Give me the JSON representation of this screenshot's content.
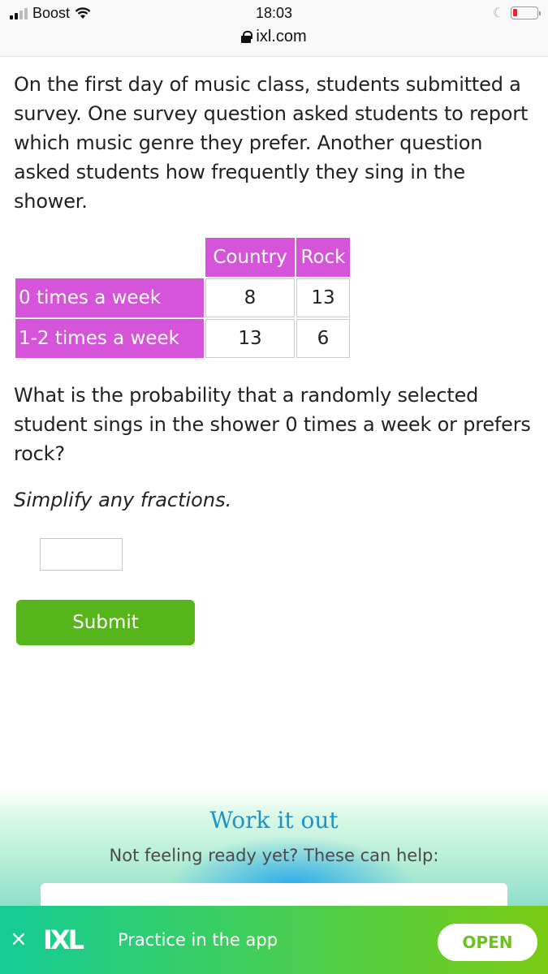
{
  "status_bar": {
    "carrier": "Boost",
    "time": "18:03",
    "url": "ixl.com",
    "icons": {
      "signal": "signal-bars-icon",
      "wifi": "wifi-icon",
      "lock": "lock-icon",
      "moon": "do-not-disturb-moon-icon",
      "battery": "battery-low-icon"
    },
    "battery_level_percent": 10,
    "battery_color": "#e8252c"
  },
  "question": {
    "intro": "On the first day of music class, students submitted a survey. One survey question asked students to report which music genre they prefer. Another question asked students how frequently they sing in the shower.",
    "table": {
      "header_color": "#d654d9",
      "columns": [
        "Country",
        "Rock"
      ],
      "rows": [
        {
          "label": "0 times a week",
          "values": [
            "8",
            "13"
          ]
        },
        {
          "label": "1-2 times a week",
          "values": [
            "13",
            "6"
          ]
        }
      ]
    },
    "prompt": "What is the probability that a randomly selected student sings in the shower 0 times a week or prefers rock?",
    "hint": "Simplify any fractions.",
    "answer_value": "",
    "submit_label": "Submit",
    "submit_color": "#56b51a"
  },
  "work_it_out": {
    "title": "Work it out",
    "subtitle": "Not feeling ready yet? These can help:"
  },
  "app_banner": {
    "close_symbol": "×",
    "logo": "IXL",
    "text": "Practice in the app",
    "open_label": "OPEN"
  }
}
